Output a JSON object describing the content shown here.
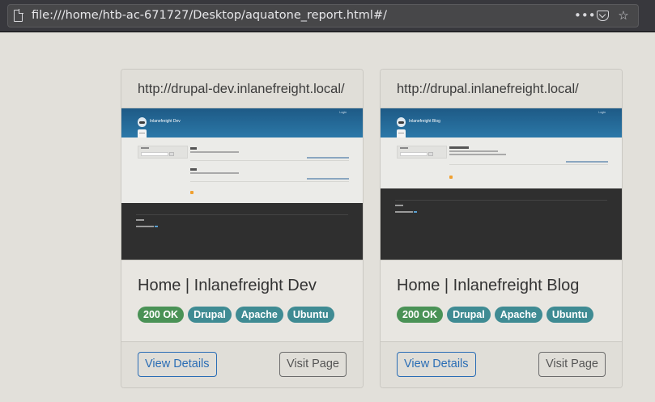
{
  "browser": {
    "url": "file:///home/htb-ac-671727/Desktop/aquatone_report.html#/",
    "actions": [
      "more-icon",
      "pocket-icon",
      "bookmark-star-icon"
    ]
  },
  "colors": {
    "tag_ok": "#4a9256",
    "tag_tech": "#3f8b93",
    "button_primary": "#2a6db5",
    "thumb_header": "#2b78a8",
    "thumb_footer": "#2f2f2f"
  },
  "cards": [
    {
      "url": "http://drupal-dev.inlanefreight.local/",
      "title": "Home | Inlanefreight Dev",
      "tags": [
        "200 OK",
        "Drupal",
        "Apache",
        "Ubuntu"
      ],
      "view_label": "View Details",
      "visit_label": "Visit Page",
      "thumbnail": {
        "site_name": "Inlanefreight Dev",
        "login": "Login"
      }
    },
    {
      "url": "http://drupal.inlanefreight.local/",
      "title": "Home | Inlanefreight Blog",
      "tags": [
        "200 OK",
        "Drupal",
        "Apache",
        "Ubuntu"
      ],
      "view_label": "View Details",
      "visit_label": "Visit Page",
      "thumbnail": {
        "site_name": "Inlanefreight Blog",
        "login": "Login"
      }
    }
  ]
}
